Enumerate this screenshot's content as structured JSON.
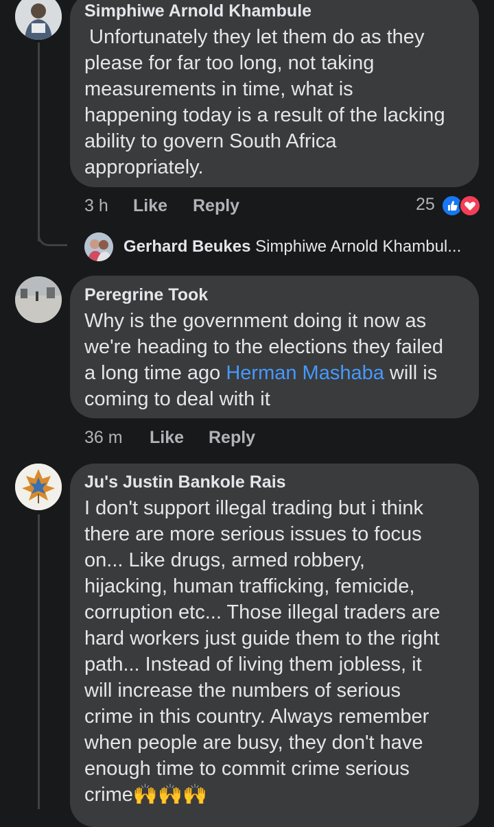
{
  "comments": [
    {
      "author": "Simphiwe Arnold Khambule",
      "lines": [
        "Unfortunately they let them do as they",
        "please for far too long, not taking",
        "measurements in time, what is",
        "happening today is a result of the lacking",
        "ability to govern South Africa",
        "appropriately."
      ],
      "time": "3 h",
      "like_label": "Like",
      "reply_label": "Reply",
      "reaction_count": "25",
      "reply_preview": {
        "author": "Gerhard Beukes",
        "text": "Simphiwe Arnold Khambul..."
      }
    },
    {
      "author": "Peregrine Took",
      "line1": "Why is the government doing it now  as",
      "line2": "we're heading to the elections they failed",
      "line3_before": "a long time ago ",
      "line3_mention": "Herman Mashaba",
      "line3_after": " will is",
      "line4": "coming to deal with it",
      "time": "36 m",
      "like_label": "Like",
      "reply_label": "Reply"
    },
    {
      "author": "Ju's Justin Bankole Rais",
      "lines": [
        "I don't support illegal trading but i think",
        "there are more serious issues to focus",
        "on... Like drugs, armed robbery,",
        "hijacking, human trafficking, femicide,",
        "corruption etc... Those illegal traders are",
        "hard workers just guide them to the right",
        "path... Instead of living them jobless, it",
        "will increase the numbers of serious",
        "crime in this country. Always remember",
        "when people are busy, they don't have",
        "enough time to commit crime serious",
        "crime🙌🙌🙌"
      ]
    }
  ],
  "colors": {
    "background": "#18191a",
    "bubble": "#3a3b3c",
    "text": "#e4e6eb",
    "meta": "#b0b3b8",
    "mention": "#4599ff",
    "like_reaction": "#1877f2",
    "love_reaction": "#f33e58"
  },
  "icons": [
    "like-reaction-icon",
    "love-reaction-icon"
  ]
}
